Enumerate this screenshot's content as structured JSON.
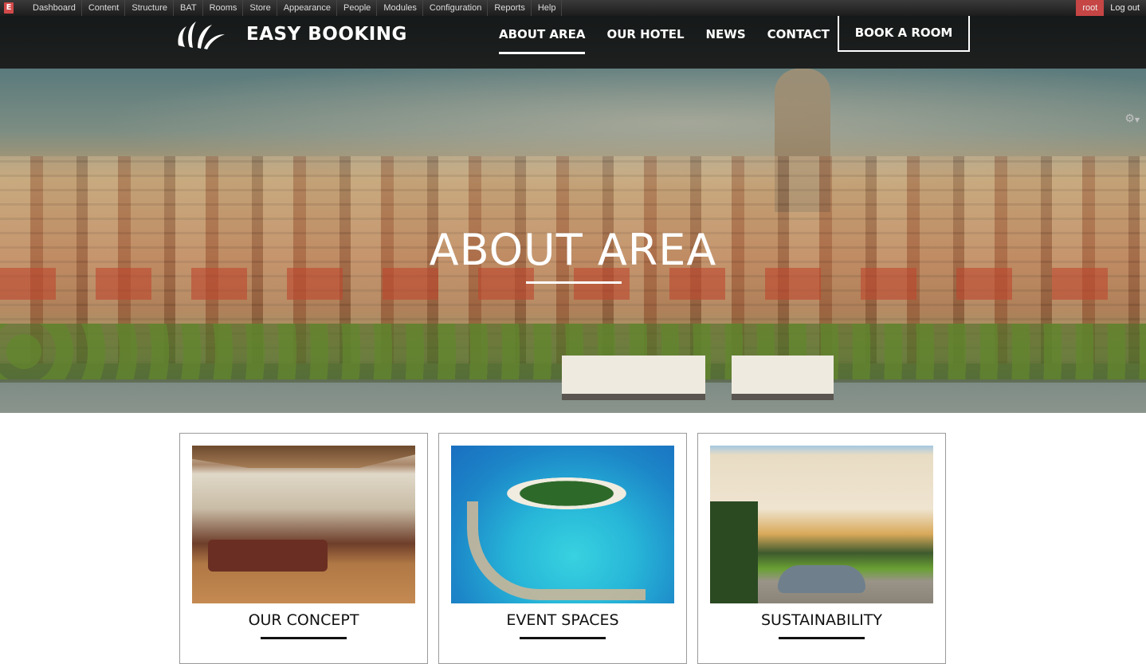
{
  "admin_toolbar": {
    "logo_letter": "E",
    "menu": [
      "Dashboard",
      "Content",
      "Structure",
      "BAT",
      "Rooms",
      "Store",
      "Appearance",
      "People",
      "Modules",
      "Configuration",
      "Reports",
      "Help"
    ],
    "user": "root",
    "logout": "Log out"
  },
  "header": {
    "brand": "EASY BOOKING",
    "nav": [
      {
        "label": "ABOUT AREA",
        "active": true
      },
      {
        "label": "OUR HOTEL",
        "active": false
      },
      {
        "label": "NEWS",
        "active": false
      },
      {
        "label": "CONTACT",
        "active": false
      }
    ],
    "cta": "BOOK A ROOM"
  },
  "hero": {
    "title": "ABOUT AREA",
    "settings_icon": "gear-icon"
  },
  "cards": [
    {
      "title": "OUR CONCEPT",
      "image": "luxury-living-room"
    },
    {
      "title": "EVENT SPACES",
      "image": "island-water-villas"
    },
    {
      "title": "SUSTAINABILITY",
      "image": "hotel-courtyard-with-car"
    }
  ],
  "colors": {
    "toolbar_bg": "#1c1c1c",
    "user_badge": "#c64545",
    "header_bg": "#1a1d1d",
    "text_light": "#ffffff",
    "card_border": "#9a9a9a"
  }
}
